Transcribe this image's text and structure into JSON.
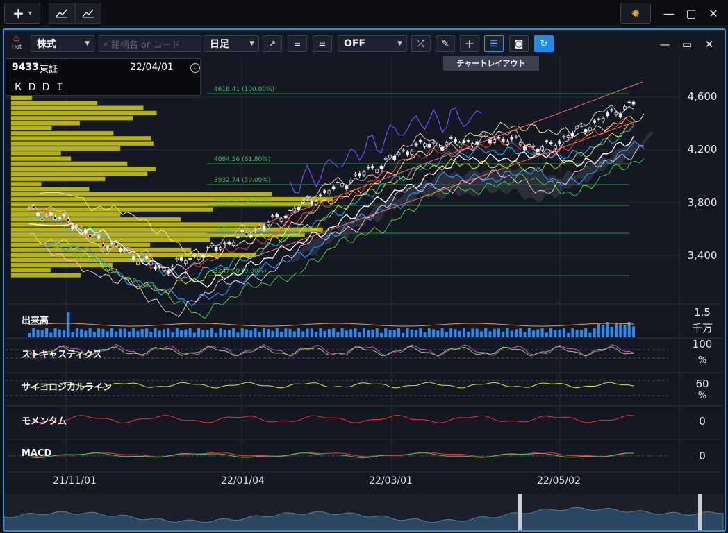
{
  "titlebar": {
    "add_icon": "plus-icon",
    "tabs": [
      "line-chart-icon",
      "line-chart-icon"
    ],
    "gear_icon": "gear-icon",
    "window_icons": [
      "minimize-icon",
      "maximize-icon",
      "close-icon"
    ]
  },
  "toolbar": {
    "hot_label": "Hot",
    "market_select": "株式",
    "search_placeholder": "銘柄名 or コード",
    "period_select": "日足",
    "toggle_select": "OFF",
    "tooltip": "チャートレイアウト",
    "icons": [
      "trend-arrow-icon",
      "bars-left-icon",
      "bars-right-icon",
      "shuffle-icon",
      "pen-icon",
      "crosshair-icon",
      "layout-settings-icon",
      "camera-icon",
      "refresh-icon"
    ]
  },
  "info": {
    "code": "9433",
    "market": "東証",
    "date": "22/04/01",
    "name": "ＫＤＤＩ"
  },
  "fibonacci": [
    {
      "label": "4618.41 (100.00%)"
    },
    {
      "label": "4094.56 (61.80%)"
    },
    {
      "label": "3932.74 (50.00%)"
    },
    {
      "label": "3770.92 (38.20%)"
    },
    {
      "label": "3608.75 (23.60%)"
    },
    {
      "label": "3247.00 (0.00%)"
    }
  ],
  "price_axis": [
    "4,600",
    "4,200",
    "3,800",
    "3,400"
  ],
  "panels": {
    "volume": {
      "label": "出来高",
      "axis_value": "1.5",
      "axis_unit": "千万"
    },
    "stochastics": {
      "label": "ストキャスティクス",
      "axis_value": "100",
      "axis_unit": "%"
    },
    "psychological": {
      "label": "サイコロジカルライン",
      "axis_value": "60",
      "axis_unit": "%"
    },
    "momentum": {
      "label": "モメンタム",
      "axis_value": "0"
    },
    "macd": {
      "label": "MACD",
      "axis_value": "0"
    }
  },
  "date_axis": [
    "21/11/01",
    "22/01/04",
    "22/03/01",
    "22/05/02"
  ],
  "colors": {
    "accent": "#2f8fe0",
    "up_candle": "#ffffff",
    "fib_line": "#1f9a3a",
    "volume_bar": "#2a8cf0",
    "volume_profile": "#d4cf12"
  }
}
